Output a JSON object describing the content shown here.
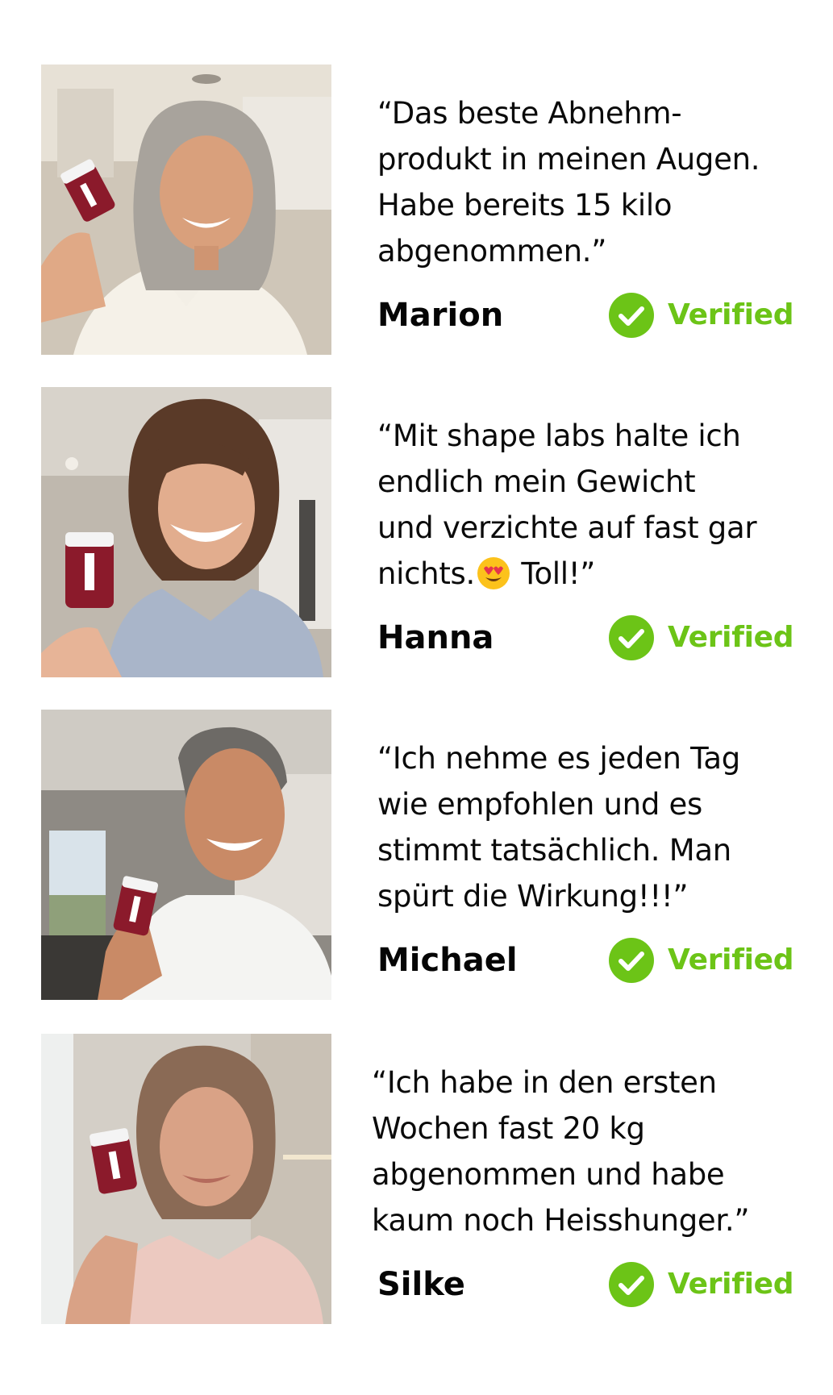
{
  "testimonials": [
    {
      "quote": "“Das beste Abnehm-\nprodukt in meinen Augen.\nHabe bereits 15 kilo\nabgenommen.”",
      "name": "Marion",
      "verified_label": "Verified",
      "photo": "woman-holding-supplement-bottle-photo"
    },
    {
      "quote_before": "“Mit shape labs halte ich\nendlich mein Gewicht\nund verzichte auf fast gar\nnichts.",
      "quote_emoji": "heart-eyes-emoji",
      "quote_after": " Toll!”",
      "name": "Hanna",
      "verified_label": "Verified",
      "photo": "woman-holding-supplement-bottle-photo"
    },
    {
      "quote": "“Ich nehme es jeden Tag\nwie empfohlen und es\nstimmt tatsächlich. Man\nspürt die Wirkung!!!”",
      "name": "Michael",
      "verified_label": "Verified",
      "photo": "man-holding-supplement-bottle-photo"
    },
    {
      "quote": "“Ich habe in den ersten\nWochen fast 20 kg\nabgenommen und habe\nkaum noch Heisshunger.”",
      "name": "Silke",
      "verified_label": "Verified",
      "photo": "woman-holding-supplement-bottle-photo"
    }
  ],
  "colors": {
    "verified_green": "#6cc417",
    "text": "#0a0a0a",
    "bottle": "#8b1a2b",
    "background": "#ffffff"
  },
  "icons": {
    "verified": "check-circle-icon"
  }
}
